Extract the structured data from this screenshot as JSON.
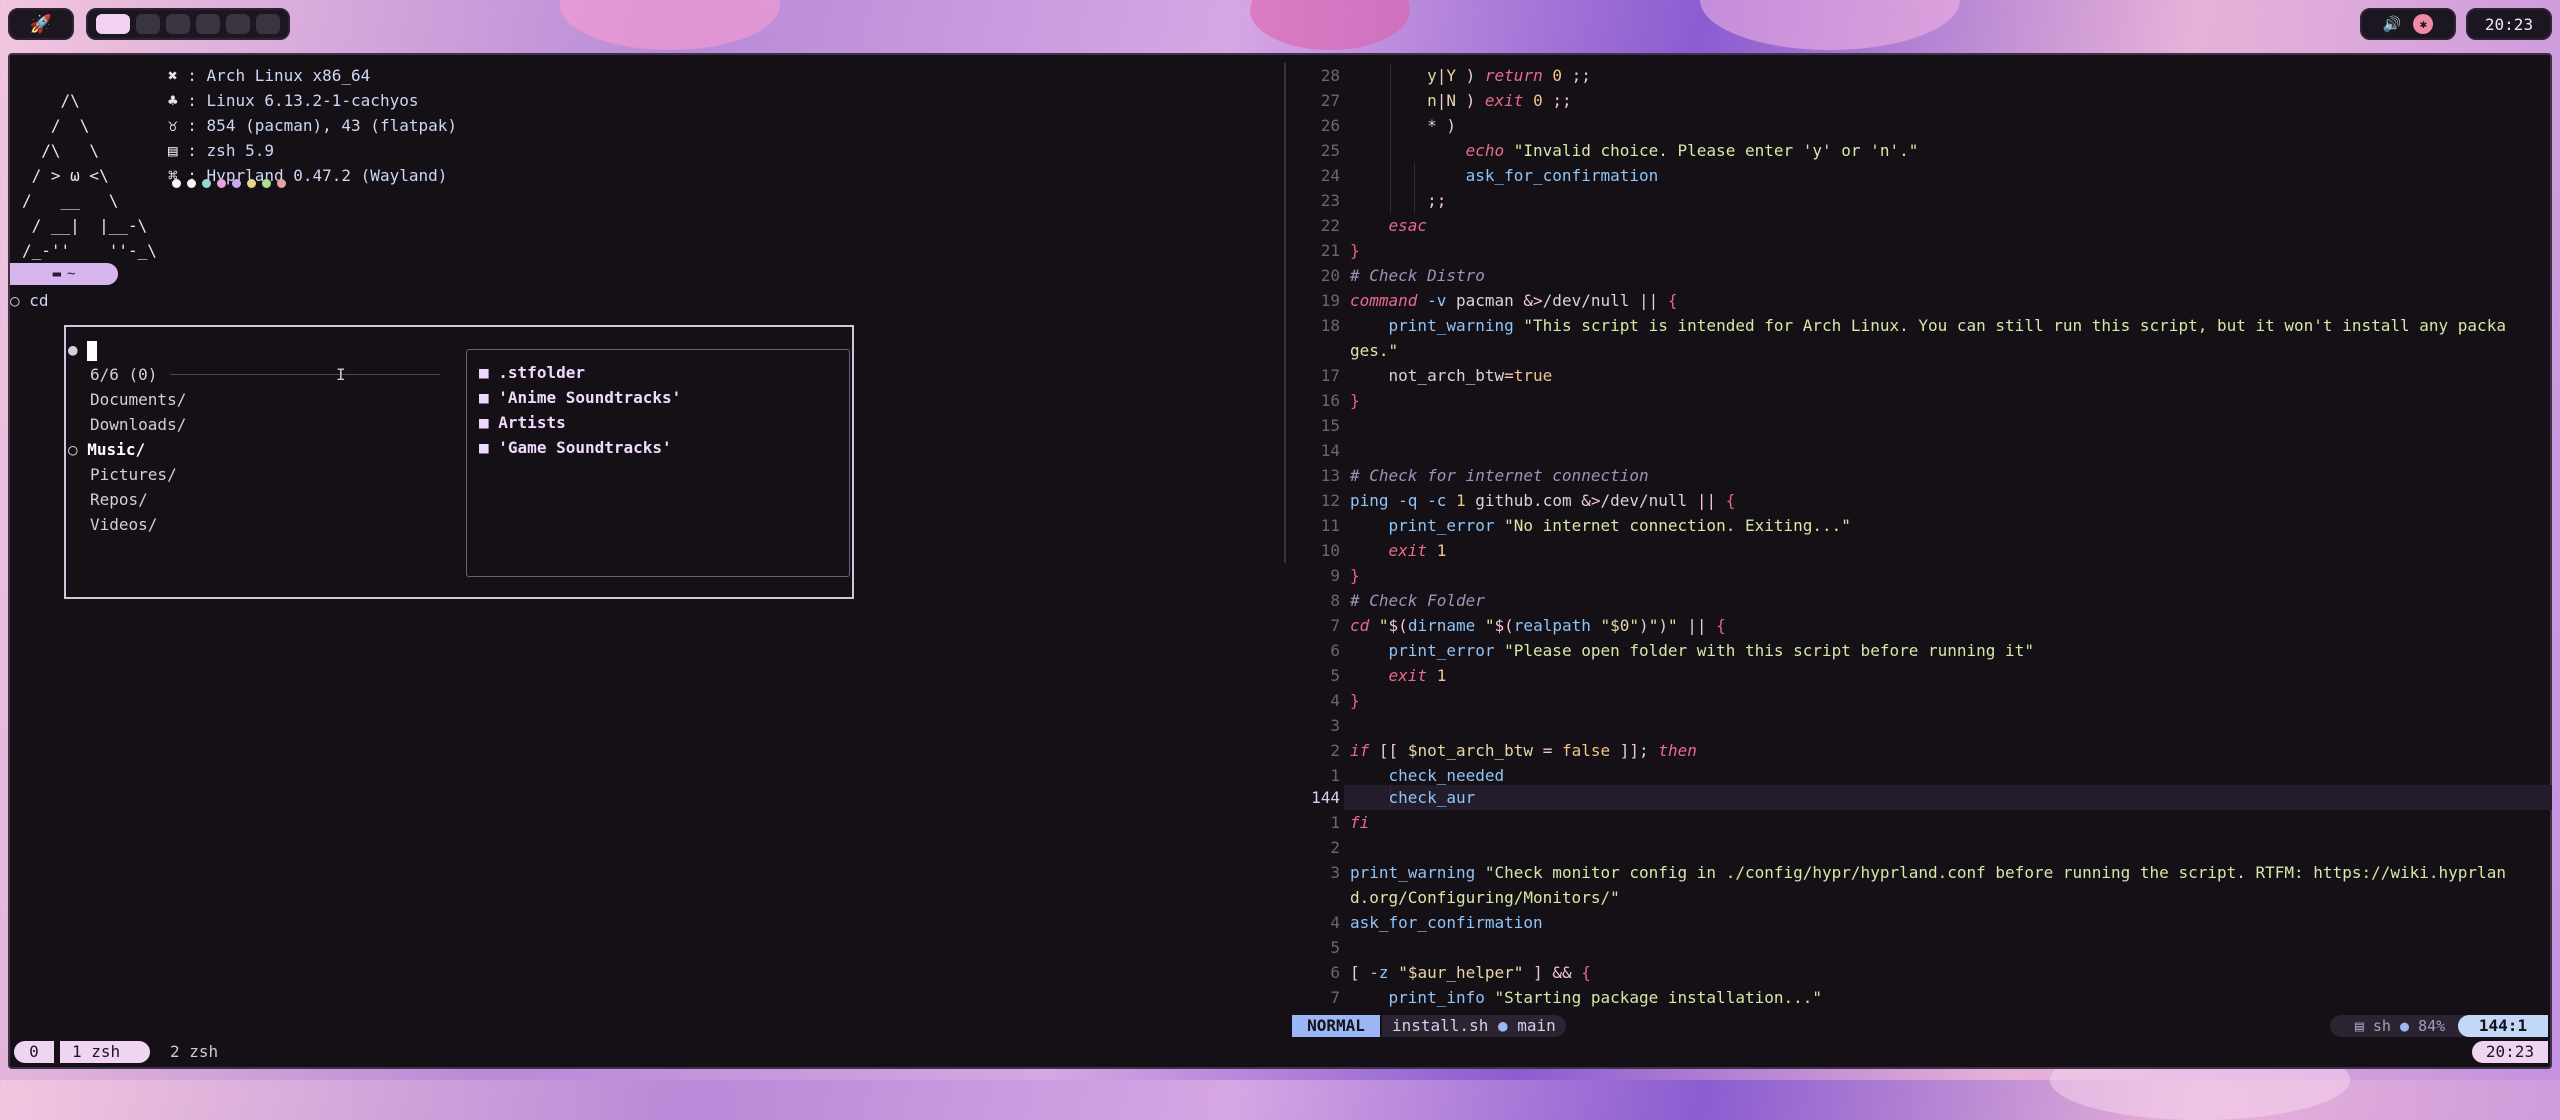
{
  "topbar": {
    "launcher_icon": "rocket-icon",
    "workspaces": [
      {
        "active": true
      },
      {
        "active": false
      },
      {
        "active": false
      },
      {
        "active": false
      },
      {
        "active": false
      },
      {
        "active": false
      }
    ],
    "tray_icons": [
      "volume-icon",
      "notification-icon"
    ],
    "clock": "20:23"
  },
  "fetch": {
    "logo_lines": [
      "    /\\    ",
      "   /  \\   ",
      "  /\\   \\  ",
      " / > ω <\\ ",
      "/   __   \\",
      " / __|  |__-\\",
      "/_-''    ''-_\\"
    ],
    "info": [
      {
        "icon": "arch-icon",
        "glyph": "✖",
        "text": ": Arch Linux x86_64"
      },
      {
        "icon": "kernel-icon",
        "glyph": "♣",
        "text": ": Linux 6.13.2-1-cachyos"
      },
      {
        "icon": "packages-icon",
        "glyph": "♉",
        "text": ": 854 (pacman), 43 (flatpak)"
      },
      {
        "icon": "shell-icon",
        "glyph": "▤",
        "text": ": zsh 5.9"
      },
      {
        "icon": "wm-icon",
        "glyph": "⌘",
        "text": ": Hyprland 0.47.2 (Wayland)"
      }
    ],
    "palette": [
      "#f5f5f5",
      "#f5f5f5",
      "#93d7d4",
      "#e9a1e0",
      "#c6a8f0",
      "#e8d48a",
      "#a9e08a",
      "#e7a0a0"
    ]
  },
  "prompt": {
    "dir": "~",
    "command": "cd"
  },
  "fzf": {
    "count": "6/6 (0)",
    "items": [
      "Documents/",
      "Downloads/",
      "Music/",
      "Pictures/",
      "Repos/",
      "Videos/"
    ],
    "selected": "Music/",
    "preview": [
      ".stfolder",
      "'Anime Soundtracks'",
      "Artists",
      "'Game Soundtracks'"
    ]
  },
  "editor": {
    "mode": "NORMAL",
    "filename": "install.sh",
    "branch": "main",
    "filetype": "sh",
    "percent": "84%",
    "position": "144:1",
    "current_line": "144"
  },
  "tmux": {
    "session": "0",
    "window1": "1 zsh",
    "window2": "2 zsh",
    "clock": "20:23"
  }
}
